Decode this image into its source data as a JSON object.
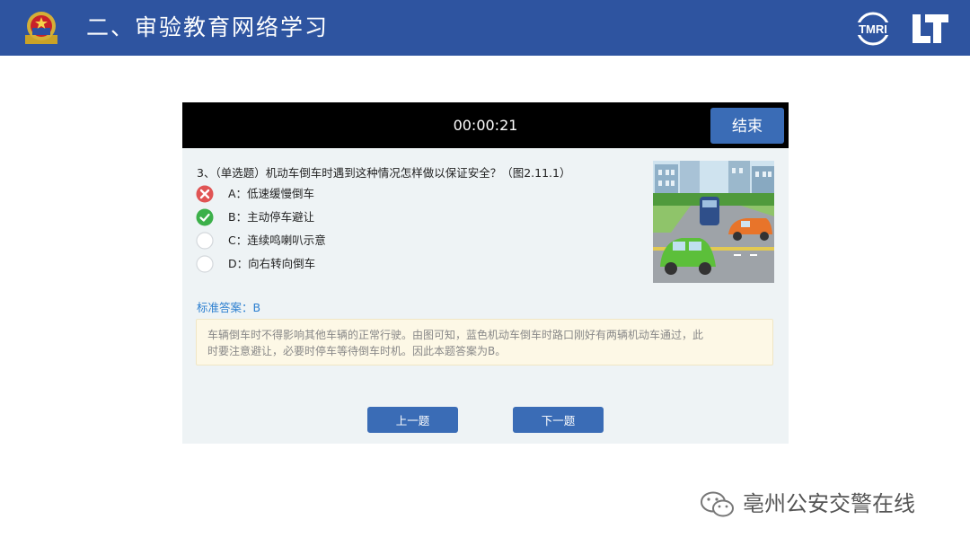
{
  "header": {
    "title": "二、审验教育网络学习",
    "emblem_icon": "police-emblem-icon",
    "logos": [
      "TMRI",
      "LT"
    ],
    "background": "#2e54a0"
  },
  "quiz": {
    "timer": "00:00:21",
    "end_label": "结束",
    "question": "3、（单选题）机动车倒车时遇到这种情况怎样做以保证安全？（图2.11.1）",
    "options": [
      {
        "label": "A：低速缓慢倒车",
        "state": "wrong",
        "icon": "wrong-mark-icon"
      },
      {
        "label": "B：主动停车避让",
        "state": "correct",
        "icon": "check-mark-icon"
      },
      {
        "label": "C：连续鸣喇叭示意",
        "state": "unselected",
        "icon": "empty-radio-icon"
      },
      {
        "label": "D：向右转向倒车",
        "state": "unselected",
        "icon": "empty-radio-icon"
      }
    ],
    "answer_label": "标准答案：B",
    "explanation_lines": [
      "车辆倒车时不得影响其他车辆的正常行驶。由图可知，蓝色机动车倒车时路口刚好有两辆机动车通过，此",
      "时要注意避让，必要时停车等待倒车时机。因此本题答案为B。"
    ],
    "prev_label": "上一题",
    "next_label": "下一题",
    "colors": {
      "accent": "#3a6cb6",
      "wrong": "#e05454",
      "correct": "#3cb04a",
      "answer": "#2c7fd0"
    }
  },
  "watermark": {
    "text": "亳州公安交警在线",
    "icon": "wechat-icon"
  }
}
